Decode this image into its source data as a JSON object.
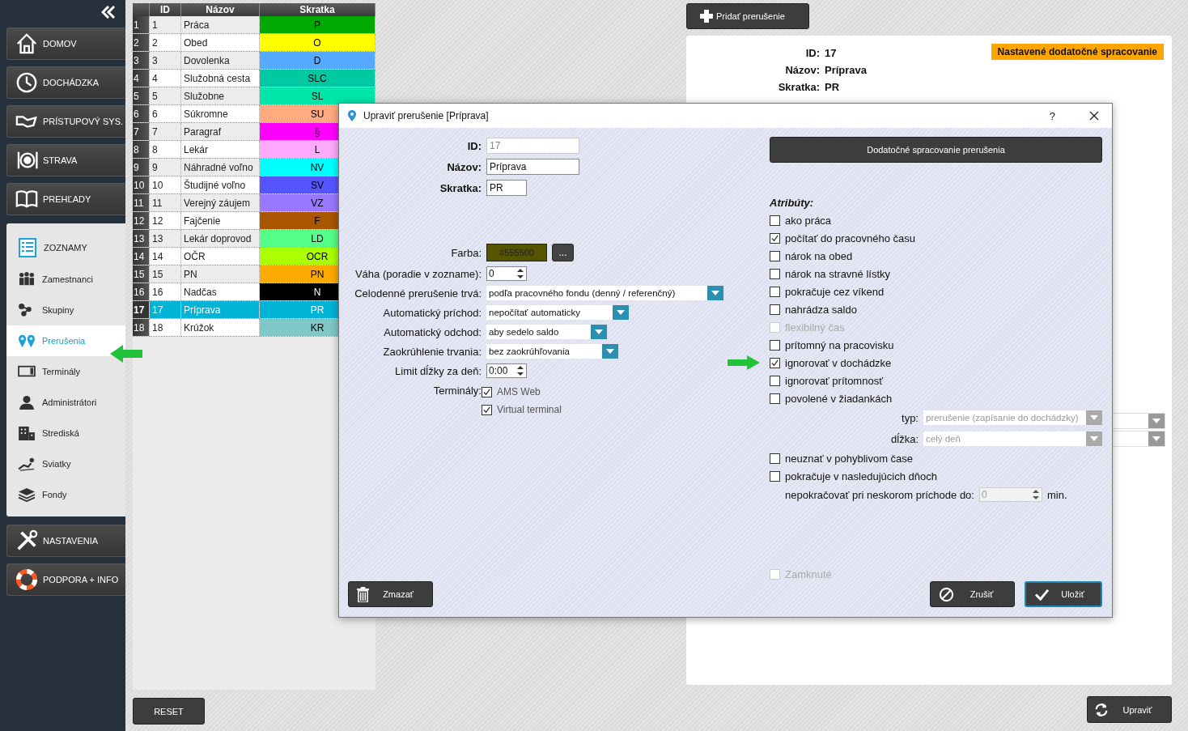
{
  "sidebar": {
    "items": [
      {
        "label": "DOMOV",
        "expanded": false
      },
      {
        "label": "DOCHÁDZKA",
        "expanded": false
      },
      {
        "label": "PRÍSTUPOVÝ SYS.",
        "expanded": false
      },
      {
        "label": "STRAVA",
        "expanded": false
      },
      {
        "label": "PREHĽADY",
        "expanded": false
      },
      {
        "label": "ZOZNAMY",
        "expanded": true,
        "children": [
          {
            "label": "Zamestnanci",
            "selected": false
          },
          {
            "label": "Skupiny",
            "selected": false
          },
          {
            "label": "Prerušenia",
            "selected": true
          },
          {
            "label": "Terminály",
            "selected": false
          },
          {
            "label": "Administrátori",
            "selected": false
          },
          {
            "label": "Strediská",
            "selected": false
          },
          {
            "label": "Sviatky",
            "selected": false
          },
          {
            "label": "Fondy",
            "selected": false
          }
        ]
      },
      {
        "label": "NASTAVENIA",
        "expanded": false
      },
      {
        "label": "PODPORA + INFO",
        "expanded": false
      }
    ]
  },
  "table": {
    "columns": [
      "ID",
      "Názov",
      "Skratka"
    ],
    "rows": [
      {
        "num": "1",
        "id": "1",
        "name": "Práca",
        "code": "P",
        "color": "#00a800",
        "selected": false
      },
      {
        "num": "2",
        "id": "2",
        "name": "Obed",
        "code": "O",
        "color": "#ffff00",
        "selected": false
      },
      {
        "num": "3",
        "id": "3",
        "name": "Dovolenka",
        "code": "D",
        "color": "#55aaff",
        "selected": false
      },
      {
        "num": "4",
        "id": "4",
        "name": "Služobná cesta",
        "code": "SLC",
        "color": "#00c8a0",
        "selected": false
      },
      {
        "num": "5",
        "id": "5",
        "name": "Služobne",
        "code": "SL",
        "color": "#00e6aa",
        "selected": false
      },
      {
        "num": "6",
        "id": "6",
        "name": "Súkromne",
        "code": "SU",
        "color": "#ffaa80",
        "selected": false
      },
      {
        "num": "7",
        "id": "7",
        "name": "Paragraf",
        "code": "§",
        "color": "#ff00ff",
        "selected": false
      },
      {
        "num": "8",
        "id": "8",
        "name": "Lekár",
        "code": "L",
        "color": "#ffaaff",
        "selected": false
      },
      {
        "num": "9",
        "id": "9",
        "name": "Náhradné voľno",
        "code": "NV",
        "color": "#00ffff",
        "selected": false
      },
      {
        "num": "10",
        "id": "10",
        "name": "Študijné voľno",
        "code": "SV",
        "color": "#5555ff",
        "selected": false
      },
      {
        "num": "11",
        "id": "11",
        "name": "Verejný záujem",
        "code": "VZ",
        "color": "#9977ff",
        "selected": false
      },
      {
        "num": "12",
        "id": "12",
        "name": "Fajčenie",
        "code": "F",
        "color": "#aa5500",
        "selected": false
      },
      {
        "num": "13",
        "id": "13",
        "name": "Lekár doprovod",
        "code": "LD",
        "color": "#55ff88",
        "selected": false
      },
      {
        "num": "14",
        "id": "14",
        "name": "OČR",
        "code": "OCR",
        "color": "#aaff00",
        "selected": false
      },
      {
        "num": "15",
        "id": "15",
        "name": "PN",
        "code": "PN",
        "color": "#ffaa00",
        "selected": false
      },
      {
        "num": "16",
        "id": "16",
        "name": "Nadčas",
        "code": "N",
        "color": "#000000",
        "selected": false
      },
      {
        "num": "17",
        "id": "17",
        "name": "Príprava",
        "code": "PR",
        "color": "#00b4d8",
        "selected": true
      },
      {
        "num": "18",
        "id": "18",
        "name": "Krúžok",
        "code": "KR",
        "color": "#80c8c8",
        "selected": false
      }
    ]
  },
  "reset_button": "RESET",
  "add_button": "Pridať prerušenie",
  "detail": {
    "fields": [
      {
        "label": "ID:",
        "value": "17"
      },
      {
        "label": "Názov:",
        "value": "Príprava"
      },
      {
        "label": "Skratka:",
        "value": "PR"
      }
    ],
    "badge": "Nastavené dodatočné spracovanie"
  },
  "edit_button": "Upraviť",
  "dialog": {
    "title": "Upraviť prerušenie [Príprava]",
    "help": "?",
    "identity": [
      {
        "label": "ID:",
        "value": "17",
        "disabled": true
      },
      {
        "label": "Názov:",
        "value": "Príprava",
        "disabled": false
      },
      {
        "label": "Skratka:",
        "value": "PR",
        "disabled": false
      }
    ],
    "settings": [
      {
        "kind": "color",
        "label": "Farba:",
        "value": "#555500",
        "button": "..."
      },
      {
        "kind": "spinner",
        "label": "Váha (poradie v zozname):",
        "value": "0"
      },
      {
        "kind": "select",
        "label": "Celodenné prerušenie trvá:",
        "value": "podľa pracovného fondu (denný / referenčný)"
      },
      {
        "kind": "select",
        "label": "Automatický príchod:",
        "value": "nepočítať automaticky"
      },
      {
        "kind": "select",
        "label": "Automatický odchod:",
        "value": "aby sedelo saldo"
      },
      {
        "kind": "select",
        "label": "Zaokrúhlenie trvania:",
        "value": "bez zaokrúhľovania"
      },
      {
        "kind": "spinner",
        "label": "Limit dĺžky za deň:",
        "value": "0:00"
      },
      {
        "kind": "checks",
        "label": "Terminály:",
        "options": [
          {
            "label": "AMS Web",
            "checked": true
          },
          {
            "label": "Virtual terminal",
            "checked": true
          }
        ]
      }
    ],
    "extra_button": "Dodatočné spracovanie prerušenia",
    "attributes_title": "Atribúty:",
    "attributes": [
      {
        "kind": "check",
        "label": "ako práca",
        "checked": false,
        "disabled": false
      },
      {
        "kind": "check",
        "label": "počítať do pracovného času",
        "checked": true,
        "disabled": false
      },
      {
        "kind": "check",
        "label": "nárok na obed",
        "checked": false,
        "disabled": false
      },
      {
        "kind": "check",
        "label": "nárok na stravné lístky",
        "checked": false,
        "disabled": false
      },
      {
        "kind": "check",
        "label": "pokračuje cez víkend",
        "checked": false,
        "disabled": false
      },
      {
        "kind": "check",
        "label": "nahrádza saldo",
        "checked": false,
        "disabled": false
      },
      {
        "kind": "check",
        "label": "flexibilný čas",
        "checked": false,
        "disabled": true
      },
      {
        "kind": "check",
        "label": "prítomný na pracovisku",
        "checked": false,
        "disabled": false
      },
      {
        "kind": "check",
        "label": "ignorovať v dochádzke",
        "checked": true,
        "disabled": false
      },
      {
        "kind": "check",
        "label": "ignorovať prítomnosť",
        "checked": false,
        "disabled": false
      },
      {
        "kind": "check",
        "label": "povolené v žiadankách",
        "checked": false,
        "disabled": false
      },
      {
        "kind": "select",
        "label": "typ:",
        "value": "prerušenie (zapísanie do dochádzky)",
        "disabled": true
      },
      {
        "kind": "select",
        "label": "dĺžka:",
        "value": "celý deň",
        "disabled": true
      },
      {
        "kind": "check",
        "label": "neuznať v pohyblivom čase",
        "checked": false,
        "disabled": false
      },
      {
        "kind": "check",
        "label": "pokračuje v nasledujúcich dňoch",
        "checked": false,
        "disabled": false
      },
      {
        "kind": "spinner",
        "label": "nepokračovať pri neskorom príchode do:",
        "value": "0",
        "unit": "min.",
        "disabled": true
      }
    ],
    "locked": {
      "label": "Zamknuté",
      "checked": false,
      "disabled": true
    },
    "buttons": [
      {
        "kind": "delete",
        "label": "Zmazať"
      },
      {
        "kind": "cancel",
        "label": "Zrušiť"
      },
      {
        "kind": "save",
        "label": "Uložiť"
      }
    ]
  }
}
